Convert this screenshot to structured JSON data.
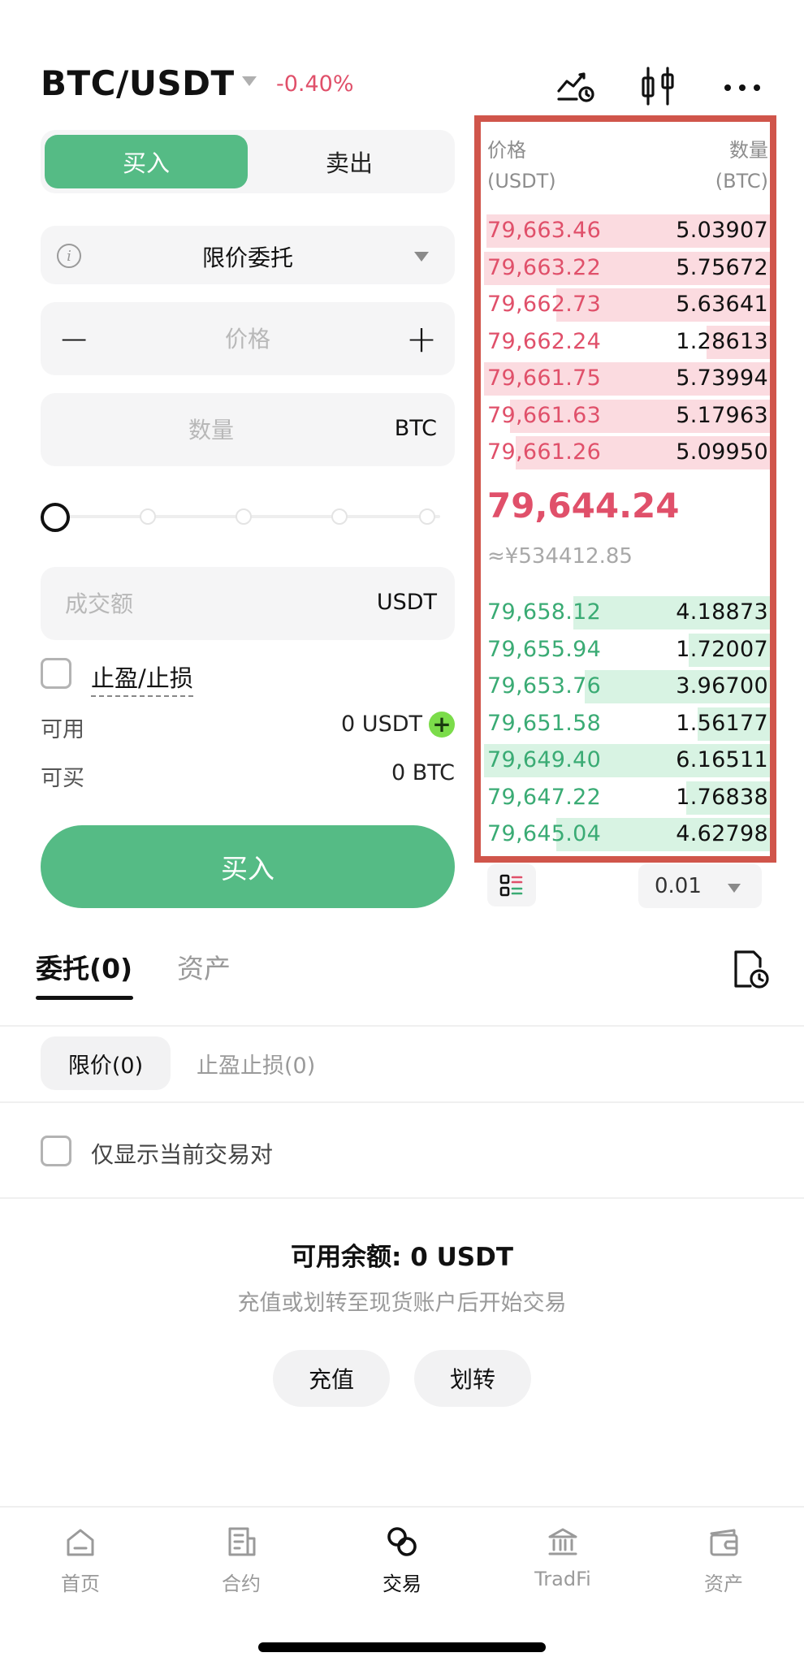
{
  "header": {
    "pair": "BTC/USDT",
    "change": "-0.40%",
    "icons": [
      "chart-alert-icon",
      "candlestick-icon",
      "more-icon"
    ]
  },
  "trade_tabs": {
    "buy": "买入",
    "sell": "卖出"
  },
  "order_type": {
    "value": "限价委托",
    "info_symbol": "i"
  },
  "price_field": {
    "placeholder": "价格",
    "minus": "−",
    "plus": "+"
  },
  "quantity_field": {
    "placeholder": "数量",
    "unit": "BTC"
  },
  "slider": {
    "fraction": 0
  },
  "turnover_field": {
    "placeholder": "成交额",
    "unit": "USDT"
  },
  "tpsl": {
    "label": "止盈/止损"
  },
  "balances": {
    "available_label": "可用",
    "available_value": "0 USDT",
    "buyable_label": "可买",
    "buyable_value": "0 BTC"
  },
  "buy_button": "买入",
  "order_book": {
    "price_header": "价格",
    "price_unit": "(USDT)",
    "qty_header": "数量",
    "qty_unit": "(BTC)",
    "asks": [
      {
        "price": "79,663.46",
        "qty": "5.03907",
        "depth": 0.98
      },
      {
        "price": "79,663.22",
        "qty": "5.75672",
        "depth": 0.99
      },
      {
        "price": "79,662.73",
        "qty": "5.63641",
        "depth": 0.74
      },
      {
        "price": "79,662.24",
        "qty": "1.28613",
        "depth": 0.22
      },
      {
        "price": "79,661.75",
        "qty": "5.73994",
        "depth": 0.99
      },
      {
        "price": "79,661.63",
        "qty": "5.17963",
        "depth": 0.9
      },
      {
        "price": "79,661.26",
        "qty": "5.09950",
        "depth": 0.88
      }
    ],
    "last_price": "79,644.24",
    "last_price_cny": "≈¥534412.85",
    "bids": [
      {
        "price": "79,658.12",
        "qty": "4.18873",
        "depth": 0.68
      },
      {
        "price": "79,655.94",
        "qty": "1.72007",
        "depth": 0.28
      },
      {
        "price": "79,653.76",
        "qty": "3.96700",
        "depth": 0.64
      },
      {
        "price": "79,651.58",
        "qty": "1.56177",
        "depth": 0.25
      },
      {
        "price": "79,649.40",
        "qty": "6.16511",
        "depth": 0.99
      },
      {
        "price": "79,647.22",
        "qty": "1.76838",
        "depth": 0.29
      },
      {
        "price": "79,645.04",
        "qty": "4.62798",
        "depth": 0.74
      }
    ],
    "precision": "0.01"
  },
  "orders_tabs": {
    "orders": "委托(0)",
    "assets": "资产"
  },
  "sub_tabs": {
    "limit": "限价(0)",
    "tpsl": "止盈止损(0)"
  },
  "only_current_pair": "仅显示当前交易对",
  "empty_state": {
    "title": "可用余额: 0 USDT",
    "subtitle": "充值或划转至现货账户后开始交易",
    "deposit": "充值",
    "transfer": "划转"
  },
  "nav": [
    {
      "label": "首页",
      "icon": "home-icon"
    },
    {
      "label": "合约",
      "icon": "contract-icon"
    },
    {
      "label": "交易",
      "icon": "trade-icon",
      "active": true
    },
    {
      "label": "TradFi",
      "icon": "bank-icon"
    },
    {
      "label": "资产",
      "icon": "wallet-icon"
    }
  ],
  "colors": {
    "buy_green": "#55bb85",
    "ask_red": "#e0506a",
    "bid_green": "#3aab74",
    "highlight_border": "#d0554b"
  }
}
